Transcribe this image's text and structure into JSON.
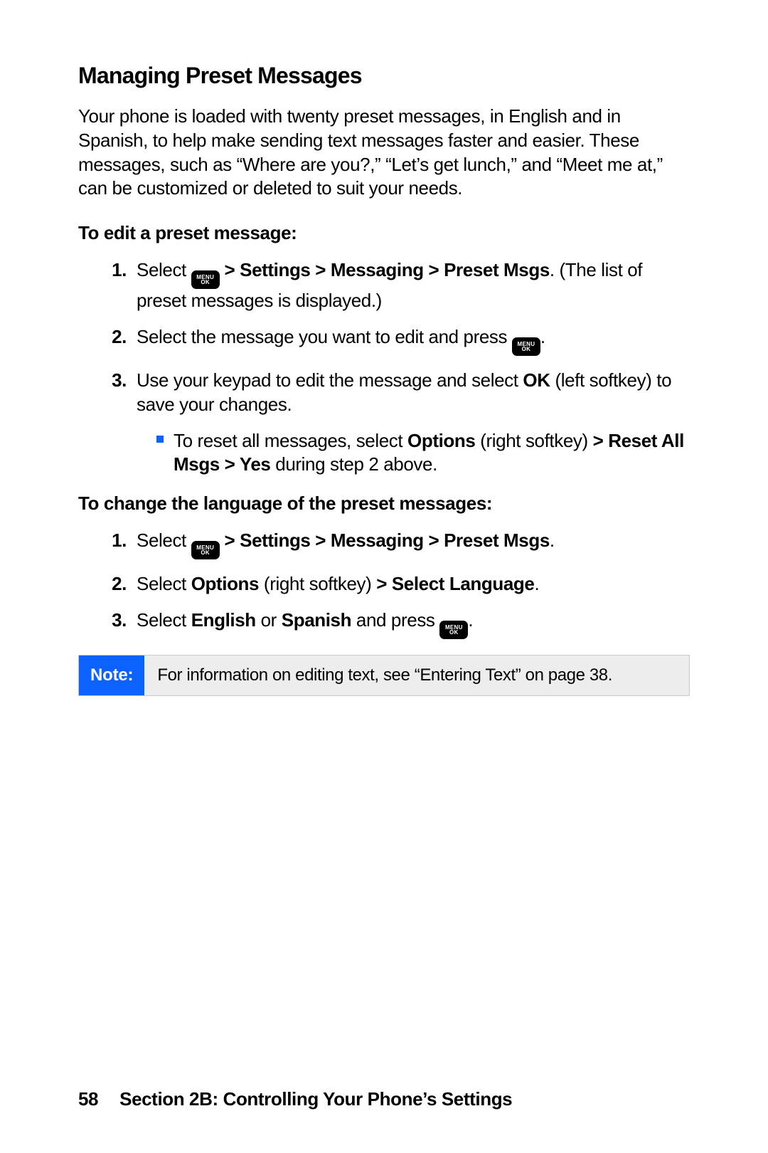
{
  "heading": "Managing Preset Messages",
  "intro": "Your phone is loaded with twenty preset messages, in English and in Spanish, to help make sending text messages faster and easier. These messages, such as “Where are you?,” “Let’s get lunch,” and “Meet me at,” can be customized or deleted to suit your needs.",
  "menu_key": {
    "top": "MENU",
    "bottom": "OK"
  },
  "edit": {
    "title": "To edit a preset message:",
    "s1": {
      "num": "1.",
      "pre": "Select ",
      "path": " > Settings > Messaging > Preset Msgs",
      "post": ". (The list of preset messages is displayed.)"
    },
    "s2": {
      "num": "2.",
      "pre": "Select the message you want to edit and press ",
      "post": "."
    },
    "s3": {
      "num": "3.",
      "pre": "Use your keypad to edit the message and select ",
      "ok": "OK",
      "post": " (left softkey) to save your changes."
    },
    "bullet": {
      "pre": "To reset all messages, select ",
      "opt": "Options",
      "mid1": " (right softkey) ",
      "arrow_reset": "> Reset All Msgs > Yes",
      "post": " during step 2 above."
    }
  },
  "lang": {
    "title": "To change the language of the preset messages:",
    "s1": {
      "num": "1.",
      "pre": "Select ",
      "path": " > Settings > Messaging > Preset Msgs",
      "post": "."
    },
    "s2": {
      "num": "2.",
      "pre": "Select ",
      "opt": "Options",
      "mid": " (right softkey) ",
      "sel": "> Select Language",
      "post": "."
    },
    "s3": {
      "num": "3.",
      "pre": "Select ",
      "en": "English",
      "or": " or ",
      "es": "Spanish",
      "mid": " and press ",
      "post": "."
    }
  },
  "note": {
    "label": "Note:",
    "body": "For information on editing text, see “Entering Text” on page 38."
  },
  "footer": {
    "page": "58",
    "section": "Section 2B: Controlling Your Phone’s Settings"
  }
}
